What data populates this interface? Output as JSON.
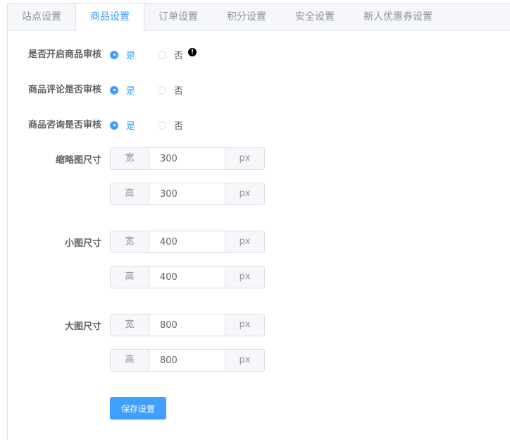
{
  "tabs": [
    {
      "label": "站点设置",
      "active": false
    },
    {
      "label": "商品设置",
      "active": true
    },
    {
      "label": "订单设置",
      "active": false
    },
    {
      "label": "积分设置",
      "active": false
    },
    {
      "label": "安全设置",
      "active": false
    },
    {
      "label": "新人优惠券设置",
      "active": false
    }
  ],
  "audit": {
    "label": "是否开启商品审核",
    "yes": "是",
    "no": "否",
    "selected": "是",
    "warning_icon": "exclamation-circle-icon"
  },
  "review_audit": {
    "label": "商品评论是否审核",
    "yes": "是",
    "no": "否",
    "selected": "是"
  },
  "consult_audit": {
    "label": "商品咨询是否审核",
    "yes": "是",
    "no": "否",
    "selected": "是"
  },
  "thumbnail": {
    "label": "缩略图尺寸",
    "width": {
      "prefix": "宽",
      "value": "300",
      "suffix": "px"
    },
    "height": {
      "prefix": "高",
      "value": "300",
      "suffix": "px"
    }
  },
  "small": {
    "label": "小图尺寸",
    "width": {
      "prefix": "宽",
      "value": "400",
      "suffix": "px"
    },
    "height": {
      "prefix": "高",
      "value": "400",
      "suffix": "px"
    }
  },
  "large": {
    "label": "大图尺寸",
    "width": {
      "prefix": "宽",
      "value": "800",
      "suffix": "px"
    },
    "height": {
      "prefix": "高",
      "value": "800",
      "suffix": "px"
    }
  },
  "save_button": "保存设置",
  "colors": {
    "primary": "#409eff",
    "border": "#dcdfe6",
    "addon_bg": "#f5f7fa"
  }
}
